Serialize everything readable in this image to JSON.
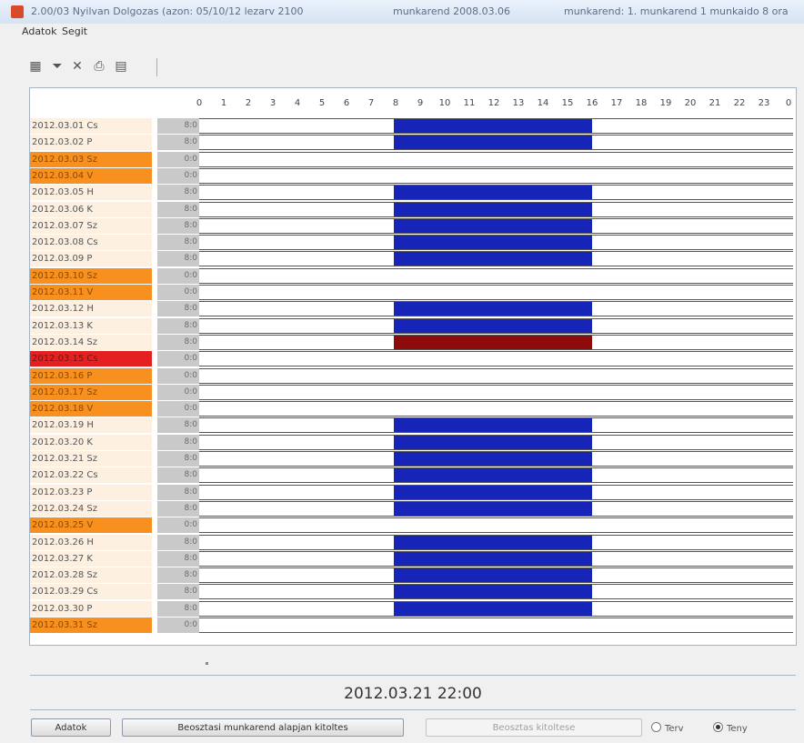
{
  "window": {
    "title_segments": [
      "2.00/03 Nyilvan Dolgozas (azon: 05/10/12 lezarv 2100",
      "munkarend 2008.03.06",
      "munkarend: 1. munkarend 1 munkaido 8 ora"
    ]
  },
  "menu": {
    "items": [
      "Adatok",
      "Segit"
    ]
  },
  "toolbar": {
    "icons": [
      "grid-icon",
      "filter-icon",
      "delete-icon",
      "print-icon",
      "save-icon"
    ]
  },
  "schedule": {
    "hours": [
      "0",
      "1",
      "2",
      "3",
      "4",
      "5",
      "6",
      "7",
      "8",
      "9",
      "10",
      "11",
      "12",
      "13",
      "14",
      "15",
      "16",
      "17",
      "18",
      "19",
      "20",
      "21",
      "22",
      "23",
      "0"
    ],
    "rows": [
      {
        "date": "2012.03.01 Cs",
        "code": "8:0",
        "type": "normal",
        "bar": "blue"
      },
      {
        "date": "2012.03.02 P",
        "code": "8:0",
        "type": "normal",
        "bar": "blue"
      },
      {
        "date": "2012.03.03 Sz",
        "code": "0:0",
        "type": "weekend",
        "bar": ""
      },
      {
        "date": "2012.03.04 V",
        "code": "0:0",
        "type": "weekend",
        "bar": ""
      },
      {
        "date": "2012.03.05 H",
        "code": "8:0",
        "type": "normal",
        "bar": "blue"
      },
      {
        "date": "2012.03.06 K",
        "code": "8:0",
        "type": "normal",
        "bar": "blue"
      },
      {
        "date": "2012.03.07 Sz",
        "code": "8:0",
        "type": "normal",
        "bar": "blue"
      },
      {
        "date": "2012.03.08 Cs",
        "code": "8:0",
        "type": "normal",
        "bar": "blue"
      },
      {
        "date": "2012.03.09 P",
        "code": "8:0",
        "type": "normal",
        "bar": "blue"
      },
      {
        "date": "2012.03.10 Sz",
        "code": "0:0",
        "type": "weekend",
        "bar": ""
      },
      {
        "date": "2012.03.11 V",
        "code": "0:0",
        "type": "weekend",
        "bar": ""
      },
      {
        "date": "2012.03.12 H",
        "code": "8:0",
        "type": "normal",
        "bar": "blue"
      },
      {
        "date": "2012.03.13 K",
        "code": "8:0",
        "type": "normal",
        "bar": "blue"
      },
      {
        "date": "2012.03.14 Sz",
        "code": "8:0",
        "type": "normal",
        "bar": "red"
      },
      {
        "date": "2012.03.15 Cs",
        "code": "0:0",
        "type": "holiday",
        "bar": ""
      },
      {
        "date": "2012.03.16 P",
        "code": "0:0",
        "type": "weekend",
        "bar": ""
      },
      {
        "date": "2012.03.17 Sz",
        "code": "0:0",
        "type": "weekend",
        "bar": ""
      },
      {
        "date": "2012.03.18 V",
        "code": "0:0",
        "type": "weekend",
        "bar": ""
      },
      {
        "date": "2012.03.19 H",
        "code": "8:0",
        "type": "normal",
        "bar": "blue"
      },
      {
        "date": "2012.03.20 K",
        "code": "8:0",
        "type": "normal",
        "bar": "blue"
      },
      {
        "date": "2012.03.21 Sz",
        "code": "8:0",
        "type": "normal",
        "bar": "blue"
      },
      {
        "date": "2012.03.22 Cs",
        "code": "8:0",
        "type": "normal",
        "bar": "blue"
      },
      {
        "date": "2012.03.23 P",
        "code": "8:0",
        "type": "normal",
        "bar": "blue"
      },
      {
        "date": "2012.03.24 Sz",
        "code": "8:0",
        "type": "normal",
        "bar": "blue"
      },
      {
        "date": "2012.03.25 V",
        "code": "0:0",
        "type": "weekend",
        "bar": ""
      },
      {
        "date": "2012.03.26 H",
        "code": "8:0",
        "type": "normal",
        "bar": "blue"
      },
      {
        "date": "2012.03.27 K",
        "code": "8:0",
        "type": "normal",
        "bar": "blue"
      },
      {
        "date": "2012.03.28 Sz",
        "code": "8:0",
        "type": "normal",
        "bar": "blue"
      },
      {
        "date": "2012.03.29 Cs",
        "code": "8:0",
        "type": "normal",
        "bar": "blue"
      },
      {
        "date": "2012.03.30 P",
        "code": "8:0",
        "type": "normal",
        "bar": "blue"
      },
      {
        "date": "2012.03.31 Sz",
        "code": "0:0",
        "type": "weekend",
        "bar": ""
      }
    ]
  },
  "status": {
    "timestamp": "2012.03.21 22:00"
  },
  "footer": {
    "btn_left": "Adatok",
    "btn_main": "Beosztasi munkarend alapjan kitoltes",
    "btn_disabled": "Beosztas kitoltese",
    "radio_1": "Terv",
    "radio_2": "Teny"
  },
  "colors": {
    "workday_bar": "#1624b8",
    "absence_bar": "#8d0b0b",
    "weekend": "#f7901e",
    "holiday": "#e52020"
  }
}
